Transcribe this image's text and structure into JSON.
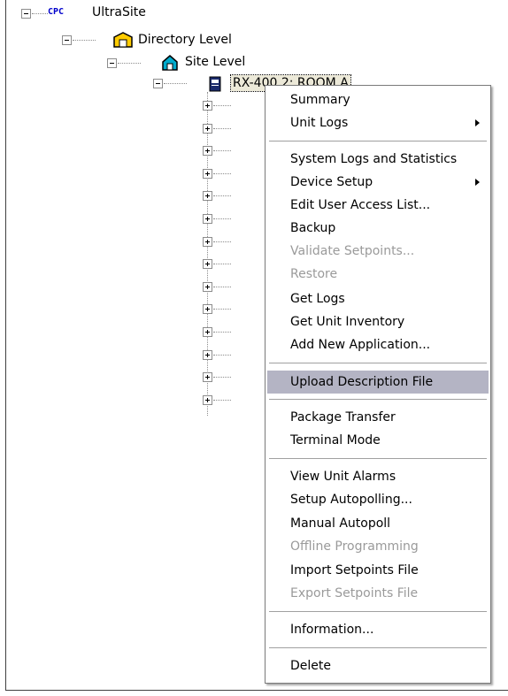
{
  "tree": {
    "root_tag": "CPC",
    "root_label": "UltraSite",
    "directory_label": "Directory Level",
    "site_label": "Site Level",
    "unit_label": "RX-400 2: ROOM A",
    "collapsed_child_count": 14
  },
  "context_menu": {
    "items": [
      {
        "label": "Summary",
        "enabled": true
      },
      {
        "label": "Unit Logs",
        "enabled": true,
        "submenu": true
      },
      {
        "label": "System Logs and Statistics",
        "enabled": true
      },
      {
        "label": "Device Setup",
        "enabled": true,
        "submenu": true
      },
      {
        "label": "Edit User Access List...",
        "enabled": true
      },
      {
        "label": "Backup",
        "enabled": true
      },
      {
        "label": "Validate Setpoints...",
        "enabled": false
      },
      {
        "label": "Restore",
        "enabled": false
      },
      {
        "label": "Get Logs",
        "enabled": true
      },
      {
        "label": "Get Unit Inventory",
        "enabled": true
      },
      {
        "label": "Add New Application...",
        "enabled": true
      },
      {
        "label": "Upload Description File",
        "enabled": true,
        "highlighted": true
      },
      {
        "label": "Package Transfer",
        "enabled": true
      },
      {
        "label": "Terminal Mode",
        "enabled": true
      },
      {
        "label": "View Unit Alarms",
        "enabled": true
      },
      {
        "label": "Setup Autopolling...",
        "enabled": true
      },
      {
        "label": "Manual Autopoll",
        "enabled": true
      },
      {
        "label": "Offline Programming",
        "enabled": false
      },
      {
        "label": "Import Setpoints File",
        "enabled": true
      },
      {
        "label": "Export Setpoints File",
        "enabled": false
      },
      {
        "label": "Information...",
        "enabled": true
      },
      {
        "label": "Delete",
        "enabled": true
      }
    ]
  },
  "colors": {
    "highlight": "#b4b4c4",
    "disabled_text": "#9a9a9a",
    "root_tag": "#0000cc"
  }
}
